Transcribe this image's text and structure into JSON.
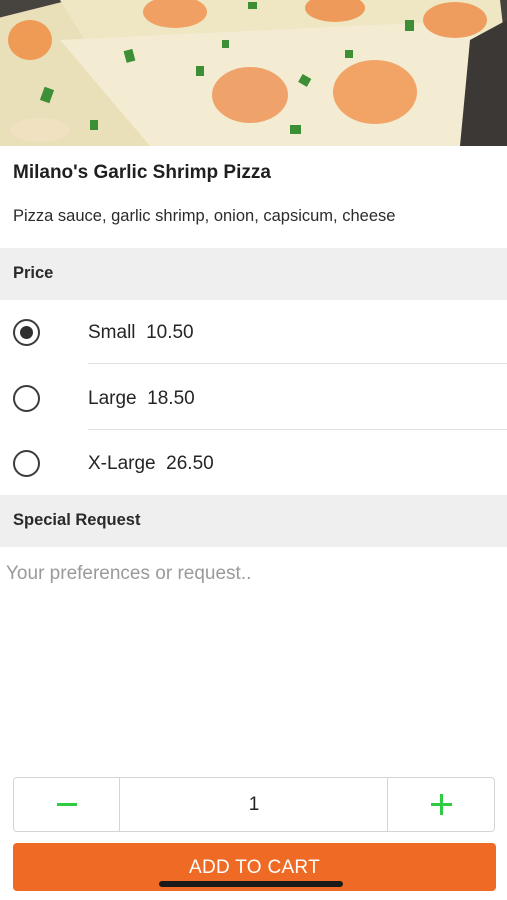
{
  "product": {
    "name": "Milano's Garlic Shrimp Pizza",
    "description": "Pizza sauce, garlic shrimp, onion, capsicum, cheese"
  },
  "price_section": {
    "heading": "Price",
    "selected_index": 0,
    "options": [
      {
        "label": "Small  10.50",
        "selected": true
      },
      {
        "label": "Large  18.50",
        "selected": false
      },
      {
        "label": "X-Large  26.50",
        "selected": false
      }
    ]
  },
  "special_request": {
    "heading": "Special Request",
    "placeholder": "Your preferences or request..",
    "value": ""
  },
  "quantity": {
    "value": "1",
    "accent": "#2ecc40"
  },
  "cart_button": {
    "label": "ADD TO CART",
    "color": "#ef6a24"
  }
}
